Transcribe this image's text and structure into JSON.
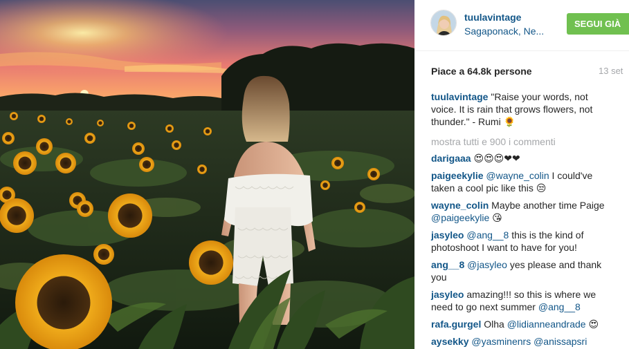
{
  "post": {
    "image_alt": "Woman in white lace playsuit walking through a sunflower field at sunset"
  },
  "header": {
    "username": "tuulavintage",
    "location": "Sagaponack, Ne...",
    "follow_label": "SEGUI GIÀ"
  },
  "stats": {
    "likes_label": "Piace a 64.8k persone",
    "date": "13 set"
  },
  "caption": {
    "author": "tuulavintage",
    "text": "\"Raise your words, not voice. It is rain that grows flowers, not thunder.\" - Rumi 🌻"
  },
  "view_all": "mostra tutti e 900 i commenti",
  "comments": [
    {
      "author": "darigaaa",
      "parts": [
        {
          "t": "text",
          "v": " 😍😍😍❤❤"
        }
      ]
    },
    {
      "author": "paigeekylie",
      "parts": [
        {
          "t": "mention",
          "v": " @wayne_colin"
        },
        {
          "t": "text",
          "v": " I could've taken a cool pic like this 😒"
        }
      ]
    },
    {
      "author": "wayne_colin",
      "parts": [
        {
          "t": "text",
          "v": " Maybe another time Paige "
        },
        {
          "t": "mention",
          "v": "@paigeekylie"
        },
        {
          "t": "text",
          "v": " 😘"
        }
      ]
    },
    {
      "author": "jasyleo",
      "parts": [
        {
          "t": "mention",
          "v": " @ang__8"
        },
        {
          "t": "text",
          "v": " this is the kind of photoshoot I want to have for you!"
        }
      ]
    },
    {
      "author": "ang__8",
      "parts": [
        {
          "t": "mention",
          "v": " @jasyleo"
        },
        {
          "t": "text",
          "v": " yes please and thank you"
        }
      ]
    },
    {
      "author": "jasyleo",
      "parts": [
        {
          "t": "text",
          "v": " amazing!!! so this is where we need to go next summer "
        },
        {
          "t": "mention",
          "v": "@ang__8"
        }
      ]
    },
    {
      "author": "rafa.gurgel",
      "parts": [
        {
          "t": "text",
          "v": " Olha "
        },
        {
          "t": "mention",
          "v": "@lidianneandrade"
        },
        {
          "t": "text",
          "v": " 😍"
        }
      ]
    },
    {
      "author": "aysekky",
      "parts": [
        {
          "t": "mention",
          "v": " @yasminenrs"
        },
        {
          "t": "text",
          "v": " "
        },
        {
          "t": "mention",
          "v": "@anissapsri"
        }
      ]
    }
  ],
  "colors": {
    "link": "#125688",
    "follow_button": "#70c050",
    "muted": "#a5a7aa"
  },
  "icons": {
    "caption_flower": "sunflower-emoji"
  }
}
